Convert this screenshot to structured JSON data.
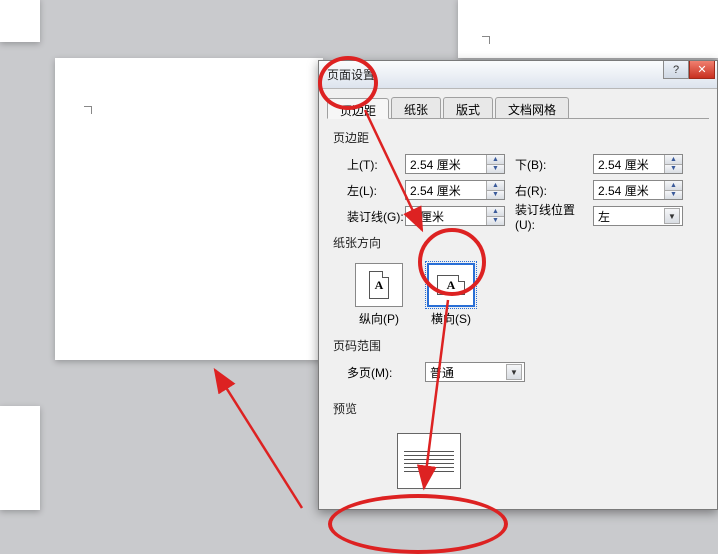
{
  "dialog": {
    "title": "页面设置",
    "tabs": {
      "margins": "页边距",
      "paper": "纸张",
      "layout": "版式",
      "grid": "文档网格"
    },
    "margins_group": "页边距",
    "fields": {
      "top_label": "上(T):",
      "top_value": "2.54 厘米",
      "bottom_label": "下(B):",
      "bottom_value": "2.54 厘米",
      "left_label": "左(L):",
      "left_value": "2.54 厘米",
      "right_label": "右(R):",
      "right_value": "2.54 厘米",
      "gutter_label": "装订线(G):",
      "gutter_value": "0 厘米",
      "gutter_pos_label": "装订线位置(U):",
      "gutter_pos_value": "左"
    },
    "orientation_group": "纸张方向",
    "orientation": {
      "portrait_label": "纵向(P)",
      "landscape_label": "横向(S)",
      "glyph": "A"
    },
    "pages_group": "页码范围",
    "multipage_label": "多页(M):",
    "multipage_value": "普通",
    "preview_label": "预览"
  },
  "window": {
    "help_icon": "?",
    "close_icon": "✕"
  }
}
